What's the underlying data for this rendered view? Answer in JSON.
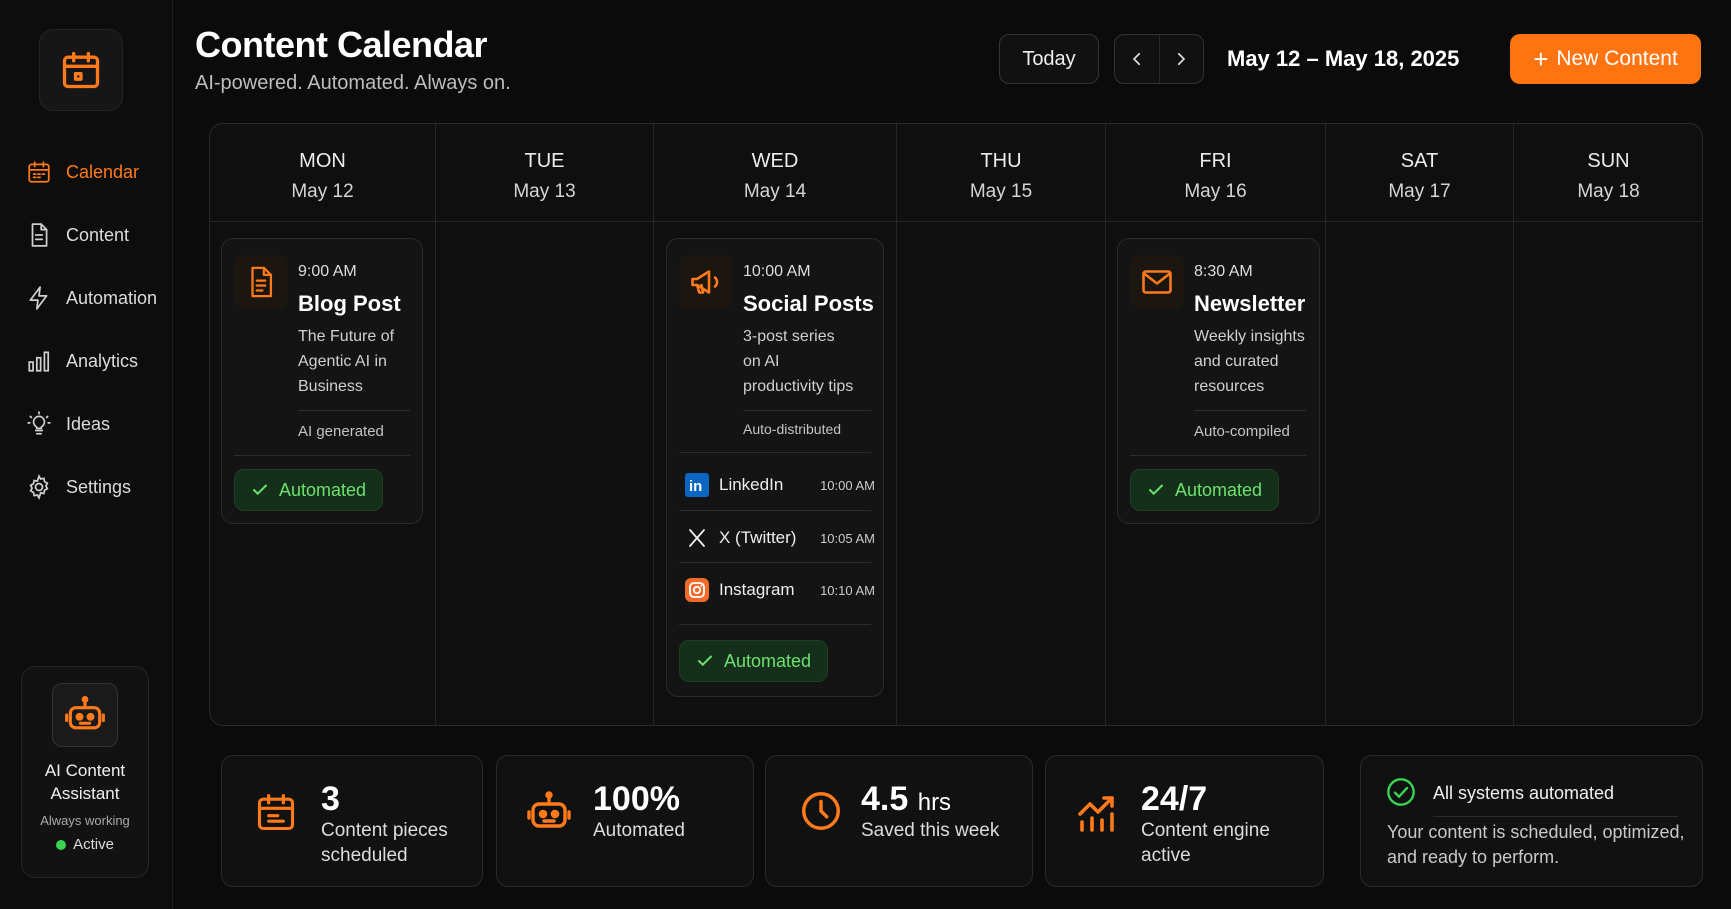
{
  "sidebar": {
    "nav": [
      {
        "label": "Calendar",
        "icon": "calendar-icon",
        "active": true
      },
      {
        "label": "Content",
        "icon": "document-icon"
      },
      {
        "label": "Automation",
        "icon": "lightning-icon"
      },
      {
        "label": "Analytics",
        "icon": "bar-chart-icon"
      },
      {
        "label": "Ideas",
        "icon": "lightbulb-icon"
      },
      {
        "label": "Settings",
        "icon": "gear-icon"
      }
    ],
    "assistant": {
      "title": "AI Content Assistant",
      "subtitle": "Always working",
      "status": "Active",
      "status_color": "#39d353"
    }
  },
  "header": {
    "title": "Content Calendar",
    "subtitle": "AI-powered. Automated. Always on.",
    "today_label": "Today",
    "date_range": "May 12 – May 18, 2025",
    "new_label": "New Content"
  },
  "calendar": {
    "days": [
      {
        "dow": "MON",
        "date": "May 12"
      },
      {
        "dow": "TUE",
        "date": "May 13"
      },
      {
        "dow": "WED",
        "date": "May 14"
      },
      {
        "dow": "THU",
        "date": "May 15"
      },
      {
        "dow": "FRI",
        "date": "May 16"
      },
      {
        "dow": "SAT",
        "date": "May 17"
      },
      {
        "dow": "SUN",
        "date": "May 18"
      }
    ],
    "events": {
      "blog": {
        "time": "9:00 AM",
        "title": "Blog Post",
        "desc": "The Future of Agentic AI in Business",
        "meta": "AI generated",
        "badge": "Automated",
        "icon": "document-icon"
      },
      "social": {
        "time": "10:00 AM",
        "title": "Social Posts",
        "desc": "3-post series on AI productivity tips",
        "meta": "Auto-distributed",
        "badge": "Automated",
        "icon": "megaphone-icon",
        "platforms": [
          {
            "name": "LinkedIn",
            "time": "10:00 AM",
            "icon": "linkedin-icon"
          },
          {
            "name": "X (Twitter)",
            "time": "10:05 AM",
            "icon": "x-icon"
          },
          {
            "name": "Instagram",
            "time": "10:10 AM",
            "icon": "instagram-icon"
          }
        ]
      },
      "newsletter": {
        "time": "8:30 AM",
        "title": "Newsletter",
        "desc": "Weekly insights and curated resources",
        "meta": "Auto-compiled",
        "badge": "Automated",
        "icon": "envelope-icon"
      }
    }
  },
  "stats": [
    {
      "value": "3",
      "unit": "",
      "label": "Content pieces scheduled",
      "icon": "calendar-icon"
    },
    {
      "value": "100%",
      "unit": "",
      "label": "Automated",
      "icon": "robot-icon"
    },
    {
      "value": "4.5",
      "unit": "hrs",
      "label": "Saved this week",
      "icon": "clock-icon"
    },
    {
      "value": "24/7",
      "unit": "",
      "label": "Content engine active",
      "icon": "trend-up-icon"
    }
  ],
  "system": {
    "title": "All systems automated",
    "desc": "Your content is scheduled, optimized, and ready to perform."
  },
  "colors": {
    "accent": "#ff7a1a",
    "success": "#6ee06e",
    "background": "#0b0b0b"
  }
}
